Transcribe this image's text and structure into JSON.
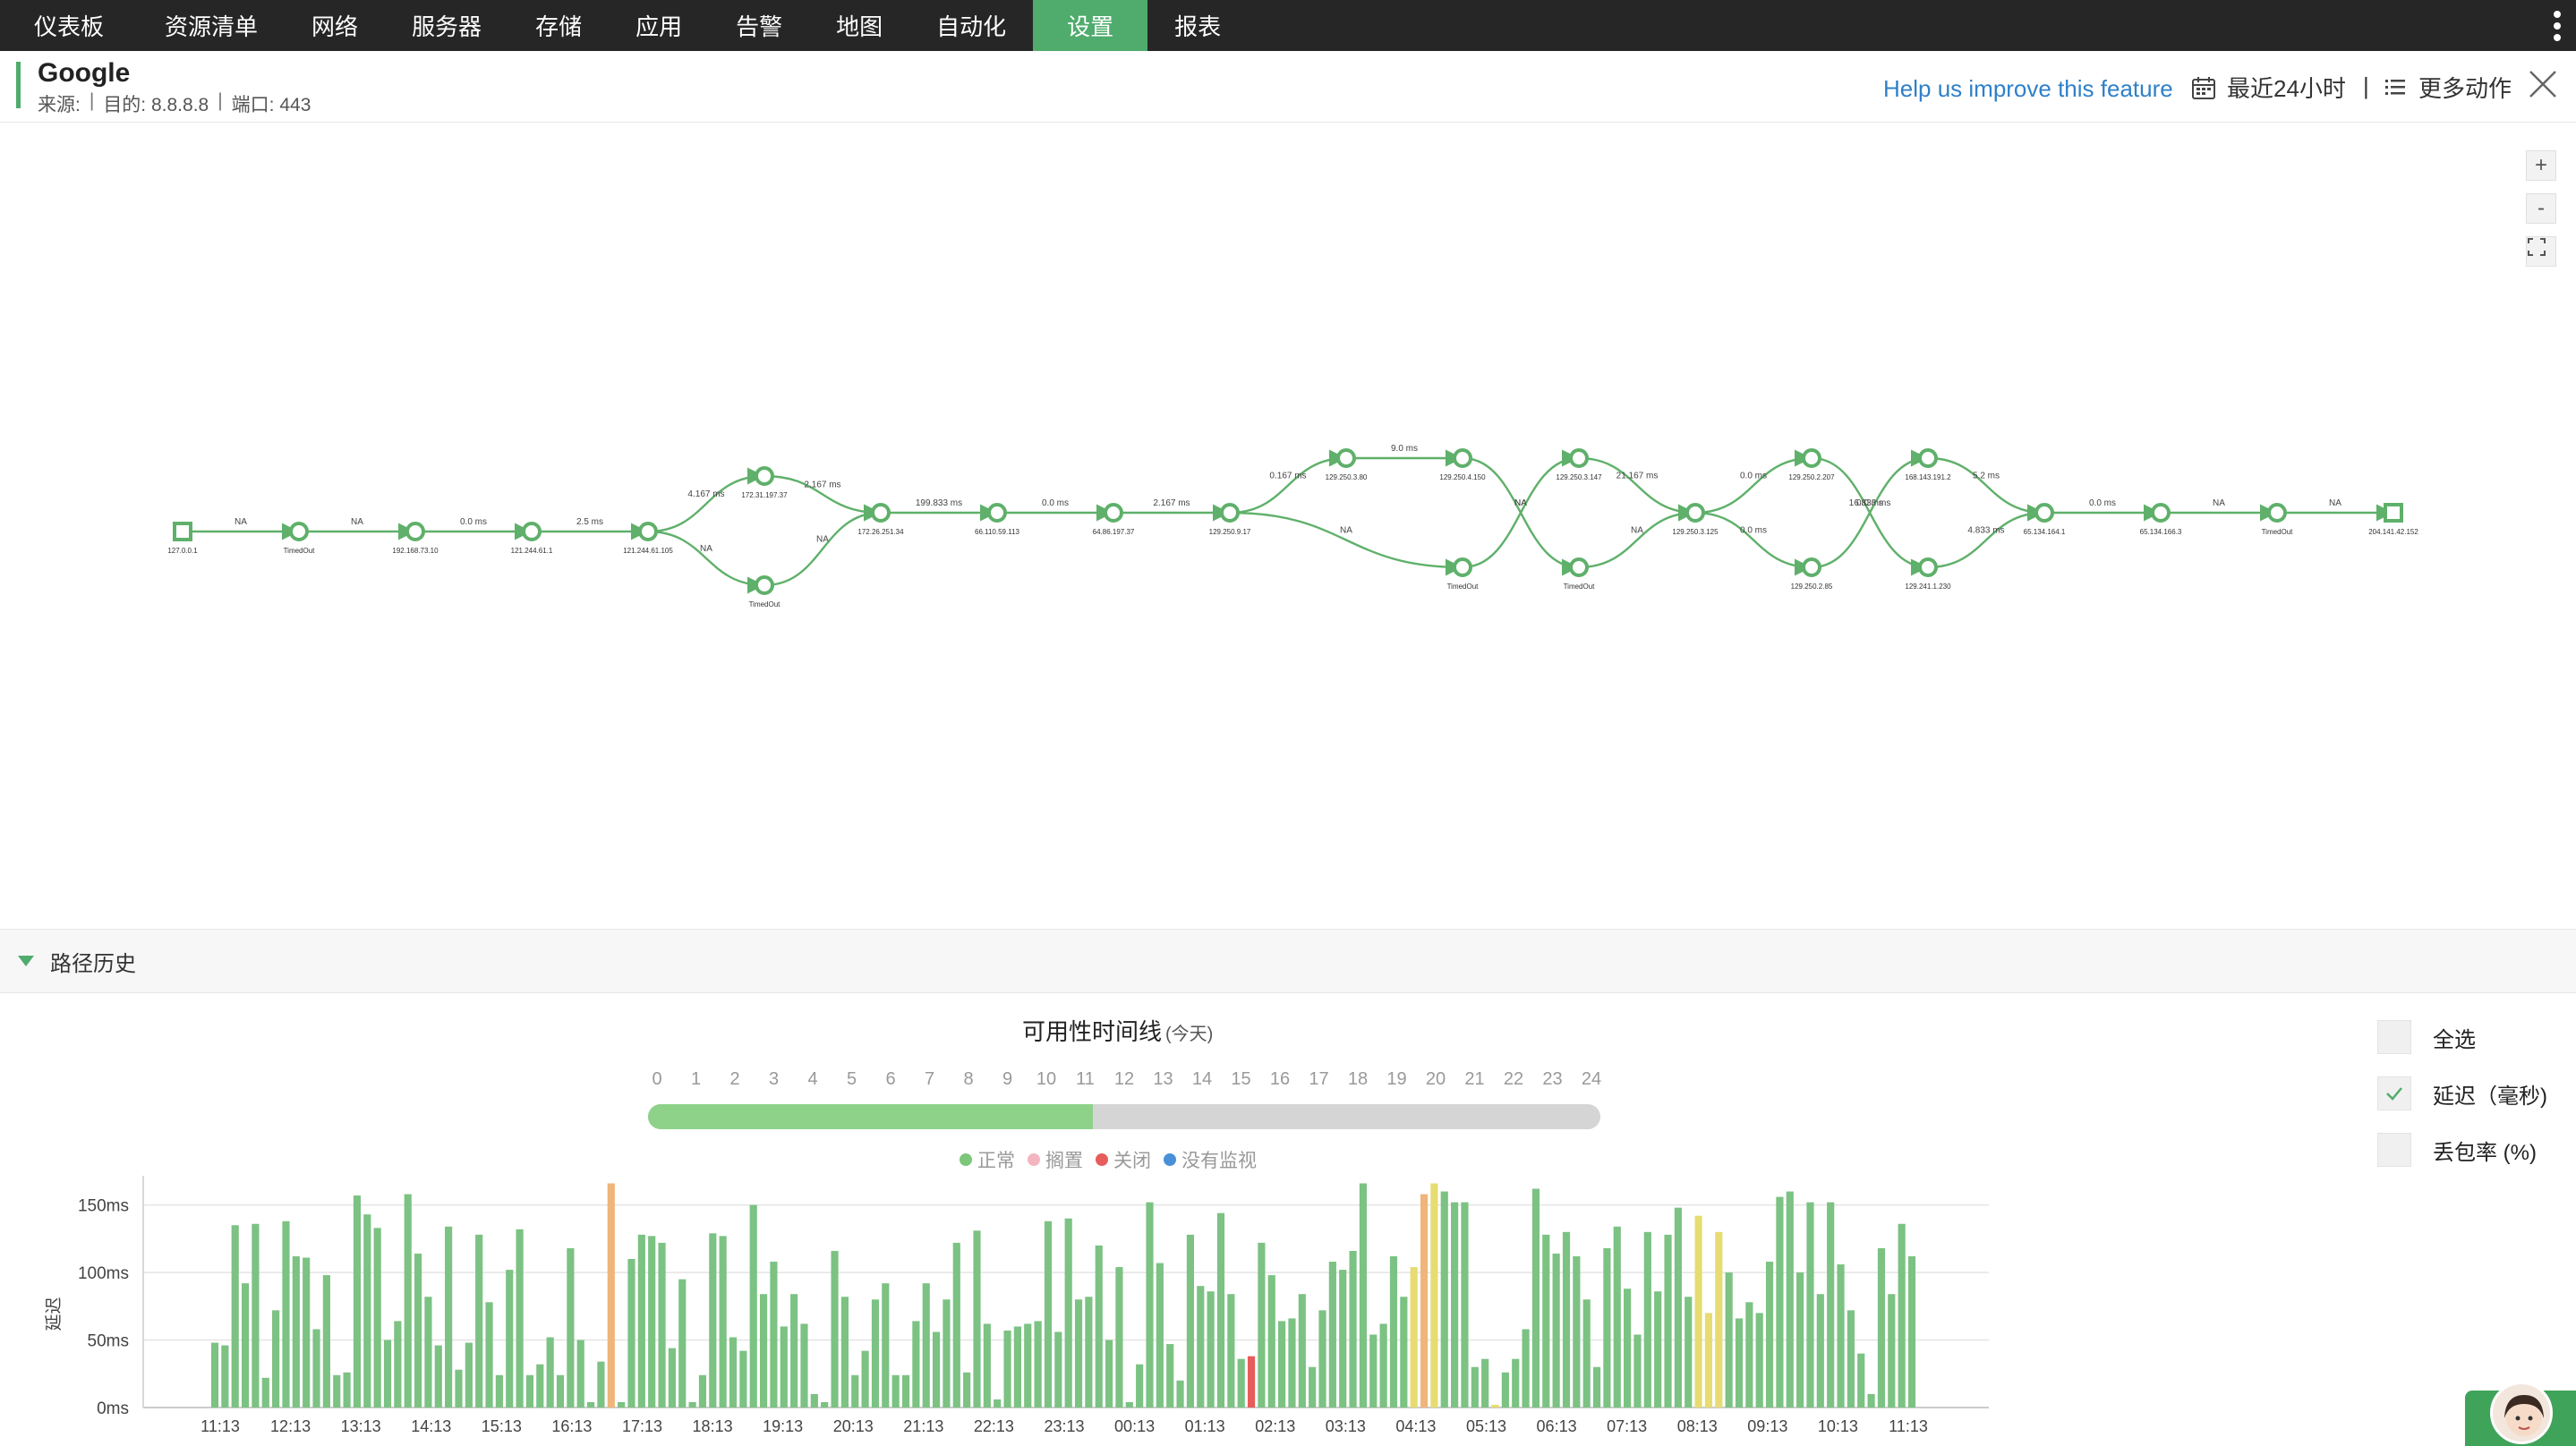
{
  "nav": {
    "items": [
      {
        "label": "仪表板",
        "active": false
      },
      {
        "label": "资源清单",
        "active": false
      },
      {
        "label": "网络",
        "active": false
      },
      {
        "label": "服务器",
        "active": false
      },
      {
        "label": "存储",
        "active": false
      },
      {
        "label": "应用",
        "active": false
      },
      {
        "label": "告警",
        "active": false
      },
      {
        "label": "地图",
        "active": false
      },
      {
        "label": "自动化",
        "active": false
      },
      {
        "label": "设置",
        "active": true
      },
      {
        "label": "报表",
        "active": false
      }
    ]
  },
  "header": {
    "title": "Google",
    "source": "来源:",
    "destination": "目的: 8.8.8.8",
    "port": "端口: 443",
    "help_link": "Help us improve this feature",
    "time_range": "最近24小时",
    "divider": "|",
    "more_actions": "更多动作"
  },
  "graph": {
    "nodes": [
      {
        "id": "n0",
        "label": "127.0.0.1",
        "shape": "square"
      },
      {
        "id": "n1",
        "label": "TimedOut"
      },
      {
        "id": "n2",
        "label": "192.168.73.10"
      },
      {
        "id": "n3",
        "label": "121.244.61.1"
      },
      {
        "id": "n4",
        "label": "121.244.61.105"
      },
      {
        "id": "n5",
        "label": "172.31.197.37"
      },
      {
        "id": "n6",
        "label": "TimedOut"
      },
      {
        "id": "n7",
        "label": "172.26.251.34"
      },
      {
        "id": "n8",
        "label": "66.110.59.113"
      },
      {
        "id": "n9",
        "label": "64.86.197.37"
      },
      {
        "id": "n10",
        "label": "129.250.9.17"
      },
      {
        "id": "n11",
        "label": "129.250.3.80"
      },
      {
        "id": "n12",
        "label": "129.250.4.150"
      },
      {
        "id": "n13",
        "label": "TimedOut"
      },
      {
        "id": "n14",
        "label": "129.250.3.147"
      },
      {
        "id": "n15",
        "label": "TimedOut"
      },
      {
        "id": "n16",
        "label": "129.250.3.125"
      },
      {
        "id": "n17",
        "label": "129.250.2.207"
      },
      {
        "id": "n18",
        "label": "129.250.2.85"
      },
      {
        "id": "n19",
        "label": "168.143.191.2"
      },
      {
        "id": "n20",
        "label": "129.241.1.230"
      },
      {
        "id": "n21",
        "label": "65.134.164.1"
      },
      {
        "id": "n22",
        "label": "65.134.166.3"
      },
      {
        "id": "n23",
        "label": "TimedOut"
      },
      {
        "id": "n24",
        "label": "204.141.42.152",
        "shape": "square"
      }
    ],
    "edges": [
      {
        "from": "n0",
        "to": "n1",
        "label": "NA"
      },
      {
        "from": "n1",
        "to": "n2",
        "label": "NA"
      },
      {
        "from": "n2",
        "to": "n3",
        "label": "0.0 ms"
      },
      {
        "from": "n3",
        "to": "n4",
        "label": "2.5 ms"
      },
      {
        "from": "n4",
        "to": "n5",
        "label": "4.167 ms"
      },
      {
        "from": "n4",
        "to": "n6",
        "label": "NA"
      },
      {
        "from": "n5",
        "to": "n7",
        "label": "2.167 ms"
      },
      {
        "from": "n6",
        "to": "n7",
        "label": "NA"
      },
      {
        "from": "n7",
        "to": "n8",
        "label": "199.833 ms"
      },
      {
        "from": "n8",
        "to": "n9",
        "label": "0.0 ms"
      },
      {
        "from": "n9",
        "to": "n10",
        "label": "2.167 ms"
      },
      {
        "from": "n10",
        "to": "n11",
        "label": "0.167 ms"
      },
      {
        "from": "n10",
        "to": "n13",
        "label": "NA"
      },
      {
        "from": "n11",
        "to": "n12",
        "label": "9.0 ms"
      },
      {
        "from": "n12",
        "to": "n15",
        "label": "NA"
      },
      {
        "from": "n13",
        "to": "n14",
        "label": "NA"
      },
      {
        "from": "n14",
        "to": "n16",
        "label": "21.167 ms"
      },
      {
        "from": "n15",
        "to": "n16",
        "label": "NA"
      },
      {
        "from": "n16",
        "to": "n17",
        "label": "0.0 ms"
      },
      {
        "from": "n16",
        "to": "n18",
        "label": "0.0 ms"
      },
      {
        "from": "n17",
        "to": "n20",
        "label": "16.833 ms"
      },
      {
        "from": "n18",
        "to": "n19",
        "label": "0.0 ms"
      },
      {
        "from": "n19",
        "to": "n21",
        "label": "5.2 ms"
      },
      {
        "from": "n20",
        "to": "n21",
        "label": "4.833 ms"
      },
      {
        "from": "n21",
        "to": "n22",
        "label": "0.0 ms"
      },
      {
        "from": "n22",
        "to": "n23",
        "label": "NA"
      },
      {
        "from": "n23",
        "to": "n24",
        "label": "NA"
      }
    ],
    "zoom_in": "+",
    "zoom_out": "-"
  },
  "history": {
    "title": "路径历史",
    "timeline_title": "可用性时间线",
    "timeline_sub": "(今天)",
    "hours": [
      "0",
      "1",
      "2",
      "3",
      "4",
      "5",
      "6",
      "7",
      "8",
      "9",
      "10",
      "11",
      "12",
      "13",
      "14",
      "15",
      "16",
      "17",
      "18",
      "19",
      "20",
      "21",
      "22",
      "23",
      "24"
    ],
    "timeline_up_fraction": 0.4667,
    "legend": [
      {
        "label": "正常",
        "color": "#7dc67a"
      },
      {
        "label": "搁置",
        "color": "#f3b6c0"
      },
      {
        "label": "关闭",
        "color": "#e85c5c"
      },
      {
        "label": "没有监视",
        "color": "#4a90d9"
      }
    ],
    "checks": [
      {
        "label": "全选",
        "checked": false
      },
      {
        "label": "延迟（毫秒)",
        "checked": true
      },
      {
        "label": "丢包率 (%)",
        "checked": false
      }
    ]
  },
  "chart_data": {
    "type": "bar",
    "ylabel": "延迟",
    "ylim": [
      0,
      165
    ],
    "yticks": [
      "150ms",
      "100ms",
      "50ms",
      "0ms"
    ],
    "ytick_values": [
      150,
      100,
      50,
      0
    ],
    "xtick_labels": [
      "11:13",
      "12:13",
      "13:13",
      "14:13",
      "15:13",
      "16:13",
      "17:13",
      "18:13",
      "19:13",
      "20:13",
      "21:13",
      "22:13",
      "23:13",
      "00:13",
      "01:13",
      "02:13",
      "03:13",
      "04:13",
      "05:13",
      "06:13",
      "07:13",
      "08:13",
      "09:13",
      "10:13",
      "11:13"
    ],
    "colors": {
      "green": "#7cc283",
      "orange": "#f0b57a",
      "red": "#e85c5c",
      "yellow": "#e6dc72"
    },
    "values": [
      48,
      46,
      135,
      92,
      136,
      22,
      72,
      138,
      112,
      111,
      58,
      98,
      24,
      26,
      157,
      143,
      133,
      50,
      64,
      158,
      114,
      82,
      46,
      134,
      28,
      48,
      128,
      78,
      24,
      102,
      132,
      24,
      32,
      52,
      24,
      118,
      50,
      4,
      34,
      166,
      4,
      110,
      128,
      127,
      122,
      44,
      95,
      4,
      24,
      129,
      127,
      52,
      42,
      150,
      84,
      108,
      60,
      84,
      62,
      10,
      4,
      116,
      82,
      24,
      42,
      80,
      92,
      24,
      24,
      64,
      92,
      56,
      80,
      122,
      26,
      131,
      62,
      6,
      57,
      60,
      62,
      64,
      138,
      56,
      140,
      80,
      82,
      120,
      50,
      104,
      4,
      32,
      152,
      107,
      47,
      20,
      128,
      90,
      86,
      144,
      84,
      36,
      38,
      122,
      98,
      64,
      66,
      84,
      30,
      72,
      108,
      102,
      116,
      166,
      54,
      62,
      112,
      82,
      104,
      158,
      166,
      160,
      152,
      152,
      30,
      36,
      2,
      26,
      36,
      58,
      162,
      128,
      114,
      130,
      112,
      80,
      30,
      118,
      134,
      88,
      54,
      130,
      86,
      128,
      148,
      82,
      142,
      70,
      130,
      100,
      66,
      78,
      70,
      108,
      156,
      160,
      100,
      152,
      84,
      152,
      106,
      72,
      40,
      10,
      118,
      84,
      136,
      112
    ],
    "colors_index": {
      "39": "orange",
      "102": "red",
      "118": "yellow",
      "119": "orange",
      "120": "yellow",
      "126": "yellow",
      "146": "yellow",
      "147": "yellow",
      "148": "yellow"
    }
  }
}
